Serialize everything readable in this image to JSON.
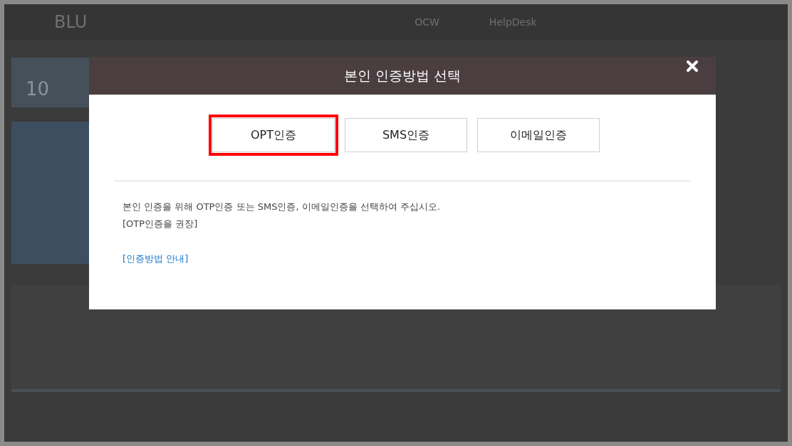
{
  "background_page": {
    "logo": "BLU",
    "nav_items": [
      "OCW",
      "HelpDesk"
    ],
    "date_day": "10"
  },
  "dialog": {
    "title": "본인 인증방법 선택",
    "buttons": [
      {
        "label": "OPT인증",
        "highlighted": true
      },
      {
        "label": "SMS인증",
        "highlighted": false
      },
      {
        "label": "이메일인증",
        "highlighted": false
      }
    ],
    "message": "본인 인증을 위해 OTP인증 또는 SMS인증, 이메일인증을 선택하여 주십시오.",
    "note": "[OTP인증을 권장]",
    "link": "[인증방법 안내]"
  }
}
